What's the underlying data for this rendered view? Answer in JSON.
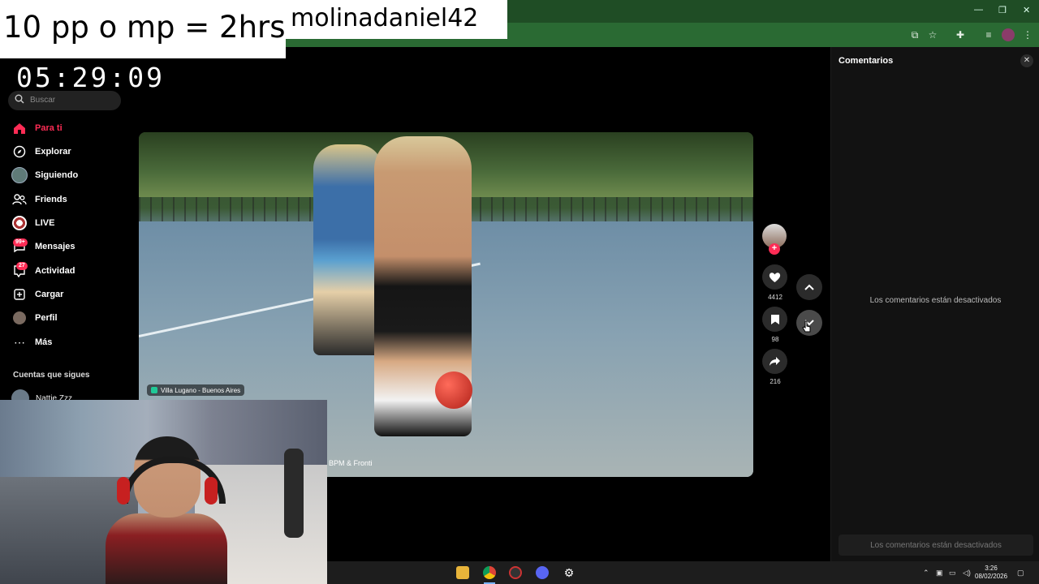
{
  "overlay": {
    "rule_text": "10 pp o mp = 2hrs",
    "username": "molinadaniel42",
    "timer": "05:29:09"
  },
  "search": {
    "placeholder": "Buscar"
  },
  "sidebar": {
    "items": [
      {
        "label": "Para ti",
        "icon": "home-icon",
        "active": true
      },
      {
        "label": "Explorar",
        "icon": "compass-icon"
      },
      {
        "label": "Siguiendo",
        "icon": "following-avatar-icon"
      },
      {
        "label": "Friends",
        "icon": "friends-icon"
      },
      {
        "label": "LIVE",
        "icon": "live-icon"
      },
      {
        "label": "Mensajes",
        "icon": "messages-icon",
        "badge": "99+"
      },
      {
        "label": "Actividad",
        "icon": "activity-icon",
        "badge": "27"
      },
      {
        "label": "Cargar",
        "icon": "upload-icon"
      },
      {
        "label": "Perfil",
        "icon": "profile-avatar-icon"
      },
      {
        "label": "Más",
        "icon": "more-dots-icon"
      }
    ],
    "following_title": "Cuentas que sigues",
    "following_first": "Nattie Zzz"
  },
  "video": {
    "location": "Villa Lugano - Buenos Aires",
    "music": "BPM & Fronti"
  },
  "actions": {
    "likes": "4412",
    "saves": "98",
    "shares": "216"
  },
  "comments": {
    "title": "Comentarios",
    "disabled_message": "Los comentarios están desactivados",
    "input_placeholder": "Los comentarios están desactivados"
  },
  "taskbar": {
    "time": "3:26",
    "date": "08/02/2026"
  },
  "colors": {
    "accent": "#fe2c55",
    "chrome_green": "#2a6a33",
    "panel_bg": "#121212"
  }
}
